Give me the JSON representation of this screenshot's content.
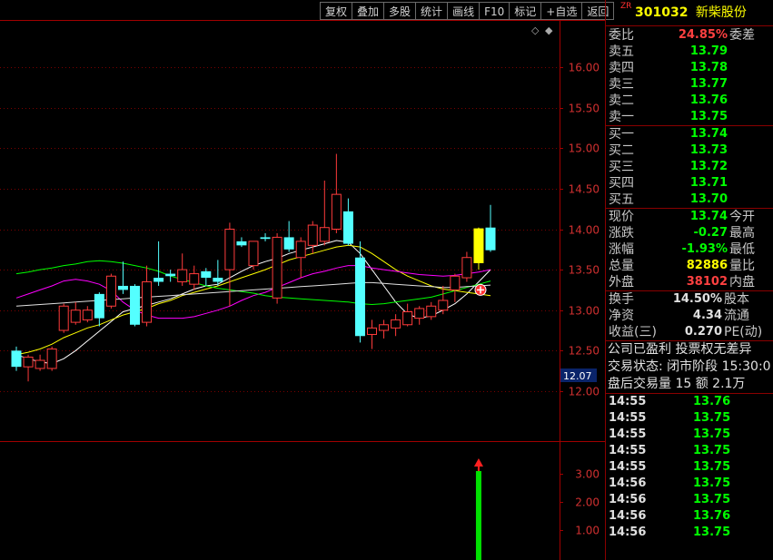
{
  "toolbar": [
    "复权",
    "叠加",
    "多股",
    "统计",
    "画线",
    "F10",
    "标记",
    "+自选",
    "返回"
  ],
  "chart_data": {
    "type": "candlestick",
    "price_axis": {
      "labels": [
        "16.00",
        "15.50",
        "15.00",
        "14.50",
        "14.00",
        "13.50",
        "13.00",
        "12.50",
        "12.00"
      ],
      "values": [
        16.0,
        15.5,
        15.0,
        14.5,
        14.0,
        13.5,
        13.0,
        12.5,
        12.0
      ],
      "ylim": [
        11.45,
        16.55
      ]
    },
    "current_price_tag": "12.07",
    "candles": [
      {
        "o": 12.5,
        "h": 12.55,
        "l": 12.25,
        "c": 12.3
      },
      {
        "o": 12.3,
        "h": 12.45,
        "l": 12.12,
        "c": 12.42
      },
      {
        "o": 12.28,
        "h": 12.45,
        "l": 12.25,
        "c": 12.38
      },
      {
        "o": 12.28,
        "h": 12.55,
        "l": 12.25,
        "c": 12.52
      },
      {
        "o": 12.75,
        "h": 13.08,
        "l": 12.72,
        "c": 13.05
      },
      {
        "o": 12.85,
        "h": 13.1,
        "l": 12.82,
        "c": 13.0
      },
      {
        "o": 12.88,
        "h": 13.05,
        "l": 12.85,
        "c": 13.0
      },
      {
        "o": 13.2,
        "h": 13.22,
        "l": 12.8,
        "c": 12.9
      },
      {
        "o": 13.05,
        "h": 13.45,
        "l": 13.02,
        "c": 13.42
      },
      {
        "o": 13.3,
        "h": 13.6,
        "l": 13.2,
        "c": 13.25
      },
      {
        "o": 13.3,
        "h": 13.32,
        "l": 12.8,
        "c": 12.82
      },
      {
        "o": 12.85,
        "h": 13.55,
        "l": 12.8,
        "c": 13.35
      },
      {
        "o": 13.4,
        "h": 13.85,
        "l": 13.3,
        "c": 13.35
      },
      {
        "o": 13.45,
        "h": 13.5,
        "l": 13.35,
        "c": 13.42
      },
      {
        "o": 13.35,
        "h": 13.7,
        "l": 13.3,
        "c": 13.5
      },
      {
        "o": 13.32,
        "h": 13.55,
        "l": 13.25,
        "c": 13.45
      },
      {
        "o": 13.48,
        "h": 13.52,
        "l": 13.3,
        "c": 13.4
      },
      {
        "o": 13.4,
        "h": 13.62,
        "l": 13.3,
        "c": 13.35
      },
      {
        "o": 13.5,
        "h": 14.08,
        "l": 13.05,
        "c": 14.0
      },
      {
        "o": 13.85,
        "h": 13.9,
        "l": 13.78,
        "c": 13.8
      },
      {
        "o": 13.55,
        "h": 13.85,
        "l": 13.5,
        "c": 13.85
      },
      {
        "o": 13.9,
        "h": 13.95,
        "l": 13.85,
        "c": 13.88
      },
      {
        "o": 13.15,
        "h": 13.95,
        "l": 13.08,
        "c": 13.9
      },
      {
        "o": 13.9,
        "h": 14.1,
        "l": 13.72,
        "c": 13.75
      },
      {
        "o": 13.65,
        "h": 13.9,
        "l": 13.4,
        "c": 13.85
      },
      {
        "o": 13.8,
        "h": 14.1,
        "l": 13.7,
        "c": 14.05
      },
      {
        "o": 13.85,
        "h": 14.6,
        "l": 13.8,
        "c": 14.02
      },
      {
        "o": 14.0,
        "h": 14.93,
        "l": 13.95,
        "c": 14.43
      },
      {
        "o": 14.22,
        "h": 14.38,
        "l": 13.8,
        "c": 13.82
      },
      {
        "o": 13.65,
        "h": 13.85,
        "l": 12.6,
        "c": 12.68
      },
      {
        "o": 12.7,
        "h": 12.88,
        "l": 12.52,
        "c": 12.78
      },
      {
        "o": 12.75,
        "h": 12.88,
        "l": 12.65,
        "c": 12.82
      },
      {
        "o": 12.78,
        "h": 12.95,
        "l": 12.68,
        "c": 12.88
      },
      {
        "o": 12.82,
        "h": 13.08,
        "l": 12.8,
        "c": 12.98
      },
      {
        "o": 12.9,
        "h": 13.05,
        "l": 12.82,
        "c": 13.02
      },
      {
        "o": 12.92,
        "h": 13.1,
        "l": 12.88,
        "c": 13.05
      },
      {
        "o": 13.0,
        "h": 13.3,
        "l": 12.95,
        "c": 13.12
      },
      {
        "o": 13.25,
        "h": 13.45,
        "l": 13.1,
        "c": 13.42
      },
      {
        "o": 13.4,
        "h": 13.72,
        "l": 13.35,
        "c": 13.65
      },
      {
        "o": 13.58,
        "h": 14.02,
        "l": 13.5,
        "c": 14.01
      },
      {
        "o": 14.02,
        "h": 14.3,
        "l": 13.72,
        "c": 13.74
      }
    ],
    "special_candle_index": 39,
    "ma_lines": [
      {
        "color": "#ffffff",
        "values": [
          12.45,
          12.4,
          12.36,
          12.34,
          12.4,
          12.5,
          12.62,
          12.74,
          12.86,
          12.98,
          13.02,
          13.06,
          13.1,
          13.14,
          13.2,
          13.26,
          13.3,
          13.32,
          13.4,
          13.48,
          13.55,
          13.6,
          13.64,
          13.7,
          13.74,
          13.78,
          13.82,
          13.86,
          13.84,
          13.7,
          13.5,
          13.3,
          13.1,
          12.95,
          12.9,
          12.93,
          13.0,
          13.08,
          13.2,
          13.35,
          13.5
        ]
      },
      {
        "color": "#ffff00",
        "values": [
          12.45,
          12.48,
          12.52,
          12.58,
          12.66,
          12.72,
          12.78,
          12.82,
          12.88,
          12.94,
          12.98,
          13.02,
          13.08,
          13.12,
          13.18,
          13.22,
          13.26,
          13.3,
          13.35,
          13.4,
          13.45,
          13.5,
          13.56,
          13.62,
          13.66,
          13.7,
          13.74,
          13.78,
          13.8,
          13.78,
          13.7,
          13.6,
          13.5,
          13.42,
          13.36,
          13.3,
          13.26,
          13.24,
          13.22,
          13.2,
          13.18
        ]
      },
      {
        "color": "#ff00ff",
        "values": [
          13.15,
          13.2,
          13.25,
          13.3,
          13.36,
          13.38,
          13.36,
          13.32,
          13.24,
          13.1,
          13.0,
          12.94,
          12.9,
          12.9,
          12.9,
          12.92,
          12.96,
          13.0,
          13.05,
          13.12,
          13.18,
          13.22,
          13.28,
          13.34,
          13.4,
          13.45,
          13.48,
          13.52,
          13.55,
          13.55,
          13.52,
          13.5,
          13.48,
          13.46,
          13.44,
          13.43,
          13.42,
          13.43,
          13.45,
          13.47,
          13.5
        ]
      },
      {
        "color": "#00ff00",
        "values": [
          13.45,
          13.47,
          13.5,
          13.52,
          13.55,
          13.57,
          13.6,
          13.61,
          13.6,
          13.58,
          13.55,
          13.52,
          13.48,
          13.42,
          13.38,
          13.34,
          13.3,
          13.27,
          13.25,
          13.23,
          13.21,
          13.18,
          13.16,
          13.15,
          13.14,
          13.13,
          13.12,
          13.11,
          13.1,
          13.08,
          13.07,
          13.08,
          13.1,
          13.12,
          13.14,
          13.16,
          13.2,
          13.24,
          13.28,
          13.32,
          13.36
        ]
      },
      {
        "color": "#e0e0e0",
        "values": [
          13.05,
          13.06,
          13.07,
          13.08,
          13.09,
          13.1,
          13.11,
          13.12,
          13.13,
          13.14,
          13.15,
          13.16,
          13.17,
          13.18,
          13.19,
          13.2,
          13.21,
          13.22,
          13.23,
          13.24,
          13.25,
          13.26,
          13.27,
          13.28,
          13.29,
          13.3,
          13.31,
          13.32,
          13.33,
          13.34,
          13.34,
          13.33,
          13.32,
          13.31,
          13.3,
          13.29,
          13.28,
          13.28,
          13.29,
          13.3,
          13.31
        ]
      }
    ],
    "volume_axis": {
      "labels": [
        "3.00",
        "2.00",
        "1.00"
      ],
      "values": [
        3.0,
        2.0,
        1.0
      ],
      "ylim": [
        0,
        4.1
      ]
    },
    "volume_bar": {
      "index": 39,
      "value": 3.1
    }
  },
  "panel": {
    "code": "301032",
    "name": "新柴股份",
    "zr_tag": "ZR",
    "commission_ratio": {
      "label": "委比",
      "value": "24.85%",
      "label2": "委差"
    },
    "asks": [
      {
        "label": "卖五",
        "price": "13.79"
      },
      {
        "label": "卖四",
        "price": "13.78"
      },
      {
        "label": "卖三",
        "price": "13.77"
      },
      {
        "label": "卖二",
        "price": "13.76"
      },
      {
        "label": "卖一",
        "price": "13.75"
      }
    ],
    "bids": [
      {
        "label": "买一",
        "price": "13.74"
      },
      {
        "label": "买二",
        "price": "13.73"
      },
      {
        "label": "买三",
        "price": "13.72"
      },
      {
        "label": "买四",
        "price": "13.71"
      },
      {
        "label": "买五",
        "price": "13.70"
      }
    ],
    "stats": [
      {
        "label": "现价",
        "value": "13.74",
        "label2": "今开",
        "color": "green"
      },
      {
        "label": "涨跌",
        "value": "-0.27",
        "label2": "最高",
        "color": "green"
      },
      {
        "label": "涨幅",
        "value": "-1.93%",
        "label2": "最低",
        "color": "green"
      },
      {
        "label": "总量",
        "value": "82886",
        "label2": "量比",
        "color": "yellow"
      },
      {
        "label": "外盘",
        "value": "38102",
        "label2": "内盘",
        "color": "red"
      }
    ],
    "stats2": [
      {
        "label": "换手",
        "value": "14.50%",
        "label2": "股本"
      },
      {
        "label": "净资",
        "value": "4.34",
        "label2": "流通"
      },
      {
        "label": "收益(三)",
        "value": "0.270",
        "label2": "PE(动)"
      }
    ],
    "info_lines": [
      "公司已盈利 投票权无差异",
      "交易状态: 闭市阶段 15:30:0",
      "盘后交易量 15 额 2.1万"
    ],
    "ticks": [
      {
        "time": "14:55",
        "price": "13.76"
      },
      {
        "time": "14:55",
        "price": "13.75"
      },
      {
        "time": "14:55",
        "price": "13.75"
      },
      {
        "time": "14:55",
        "price": "13.75"
      },
      {
        "time": "14:55",
        "price": "13.75"
      },
      {
        "time": "14:56",
        "price": "13.75"
      },
      {
        "time": "14:56",
        "price": "13.75"
      },
      {
        "time": "14:56",
        "price": "13.76"
      },
      {
        "time": "14:56",
        "price": "13.75"
      }
    ]
  }
}
